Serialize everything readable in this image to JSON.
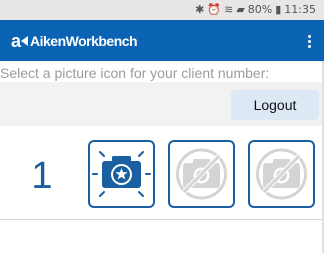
{
  "status_bar": {
    "battery": "80%",
    "time": "11:35"
  },
  "header": {
    "logo_mark": "a",
    "app_title": "AikenWorkbench"
  },
  "prompt": "Select a picture icon for your client number:",
  "logout_label": "Logout",
  "client_number": "1",
  "picture_icons": [
    {
      "icon": "camera-star-icon",
      "state": "selected"
    },
    {
      "icon": "camera-disabled-icon",
      "state": "unavailable"
    },
    {
      "icon": "camera-disabled-icon",
      "state": "unavailable"
    }
  ],
  "colors": {
    "brand": "#0b63b4",
    "accent": "#1a5fa0",
    "disabled_icon": "#d4d4d4"
  }
}
